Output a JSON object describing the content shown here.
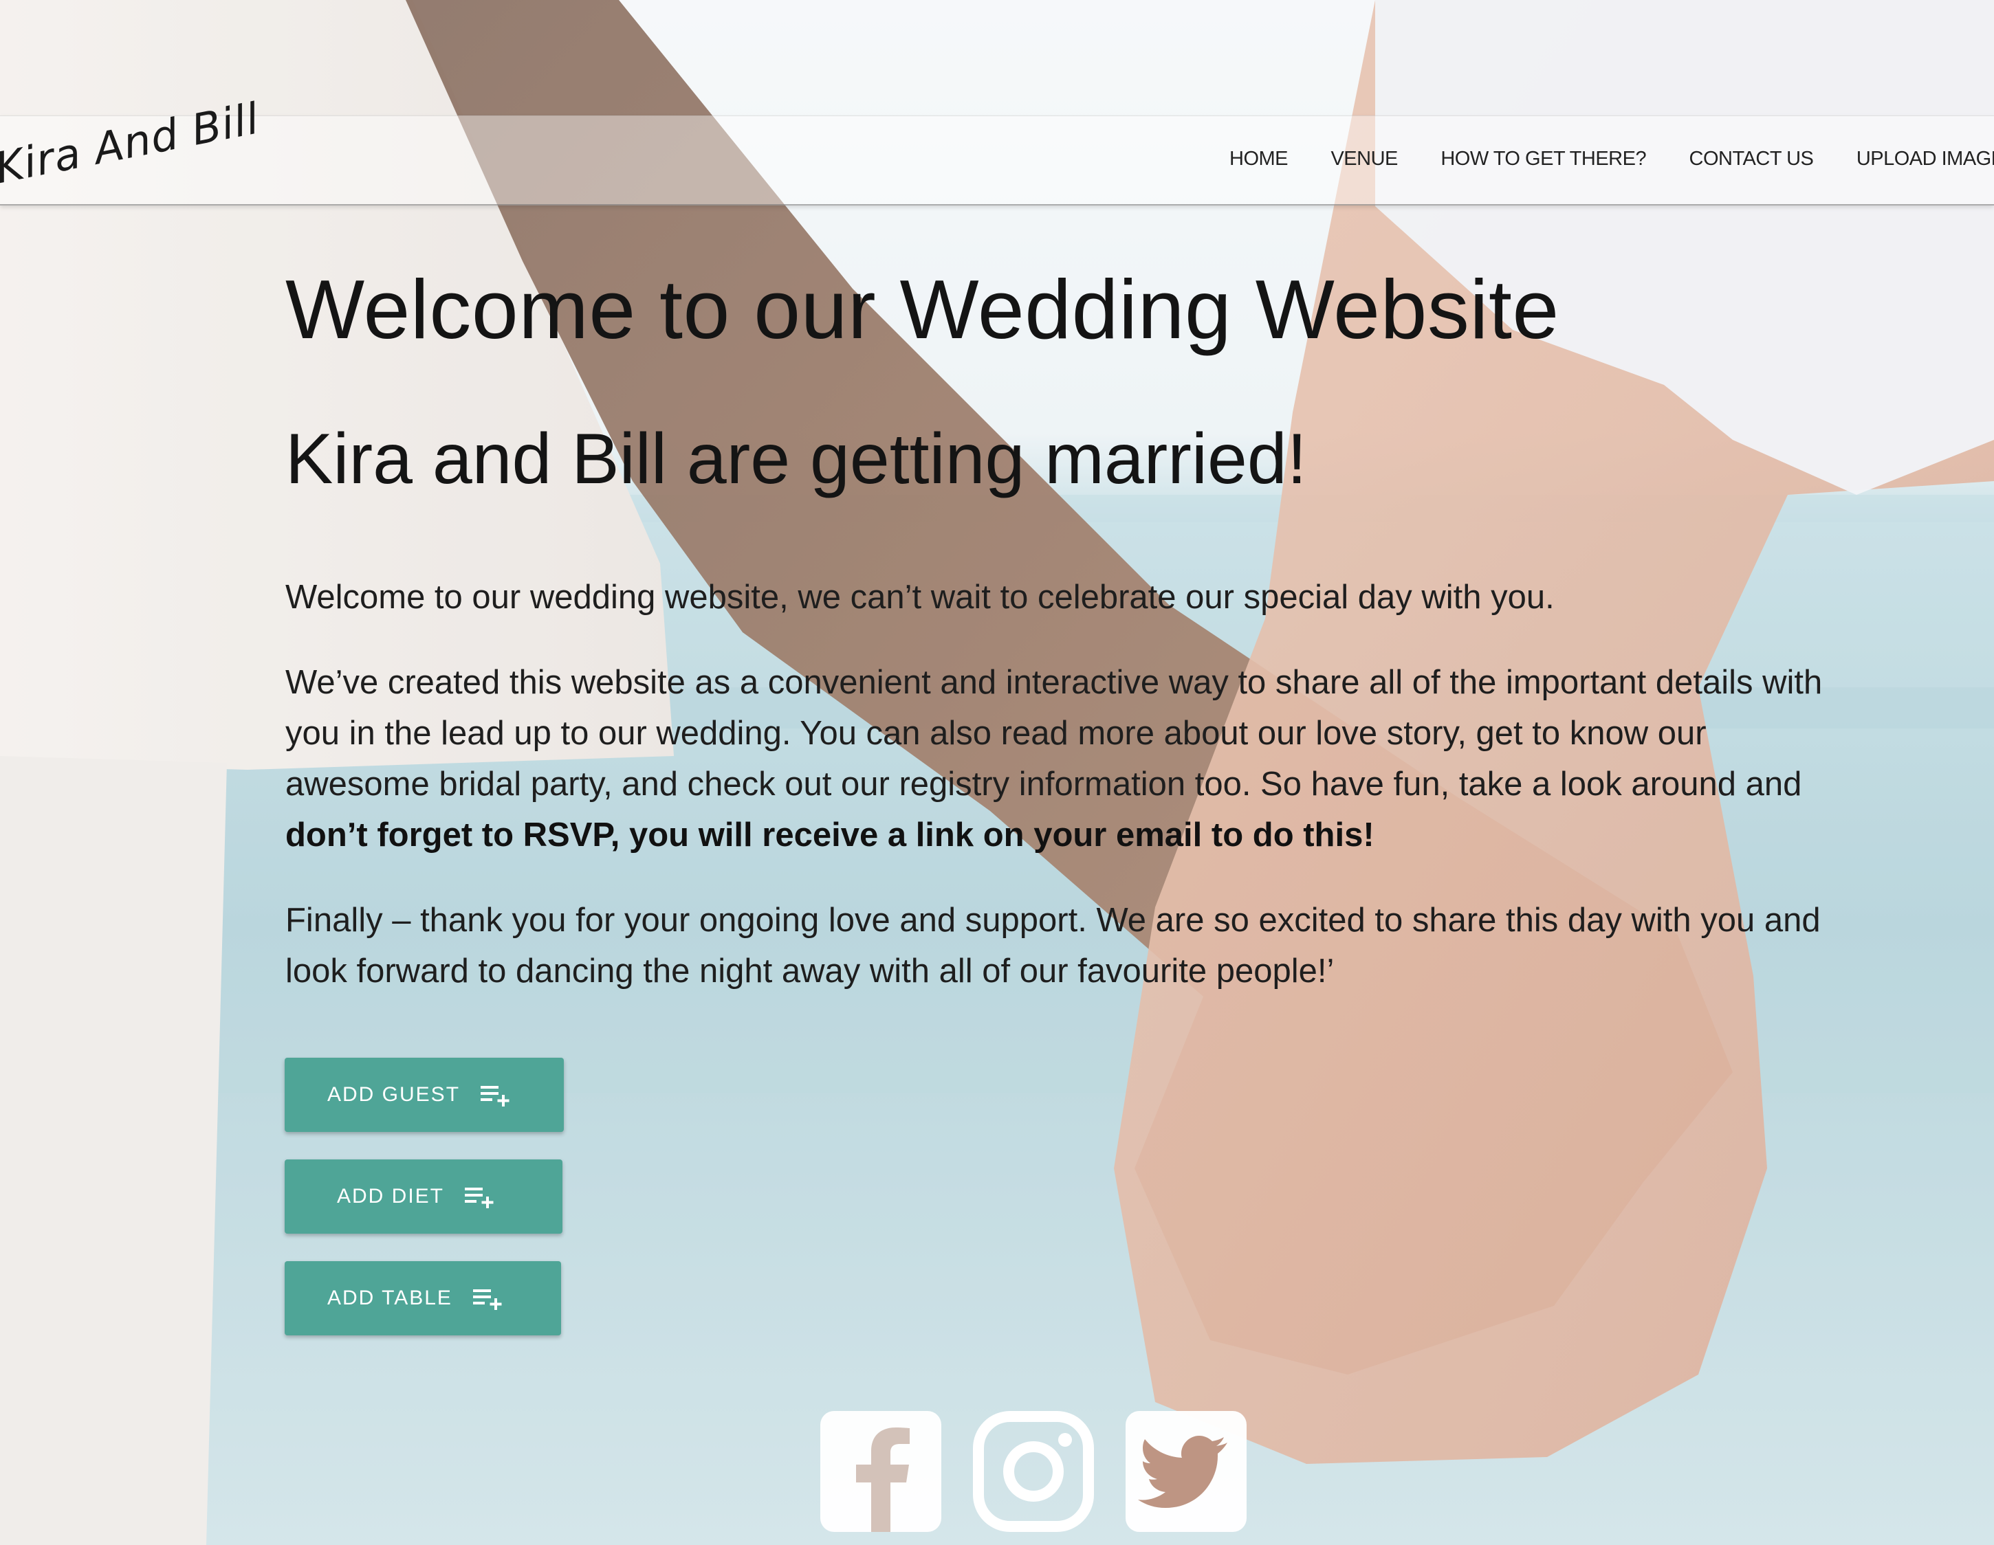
{
  "site": {
    "brand": "Kira And Bill"
  },
  "nav": {
    "items": [
      {
        "label": "HOME"
      },
      {
        "label": "VENUE"
      },
      {
        "label": "HOW TO GET THERE?"
      },
      {
        "label": "CONTACT US"
      },
      {
        "label": "UPLOAD IMAGES"
      }
    ]
  },
  "main": {
    "title": "Welcome to our Wedding Website",
    "subtitle": "Kira and Bill are getting married!",
    "p1": "Welcome to our wedding website, we can’t wait to celebrate our special day with you.",
    "p2_text": "We’ve created this website as a convenient and interactive way to share all of the important details with you in the lead up to our wedding. You can also read more about our love story, get to know our awesome bridal party, and check out our registry information too. So have fun, take a look around and ",
    "p2_bold": "don’t forget to RSVP, you will receive a link on your email to do this!",
    "p3": "Finally – thank you for your ongoing love and support. We are so excited to share this day with you and look forward to dancing the night away with all of our favourite people!’"
  },
  "buttons": {
    "add_guest": "ADD GUEST",
    "add_diet": "ADD DIET",
    "add_table": "ADD TABLE",
    "icon": "playlist-add-icon"
  },
  "social": {
    "icons": [
      "facebook-icon",
      "instagram-icon",
      "twitter-icon"
    ]
  },
  "colors": {
    "accent": "#4fa597",
    "text": "#141414"
  }
}
